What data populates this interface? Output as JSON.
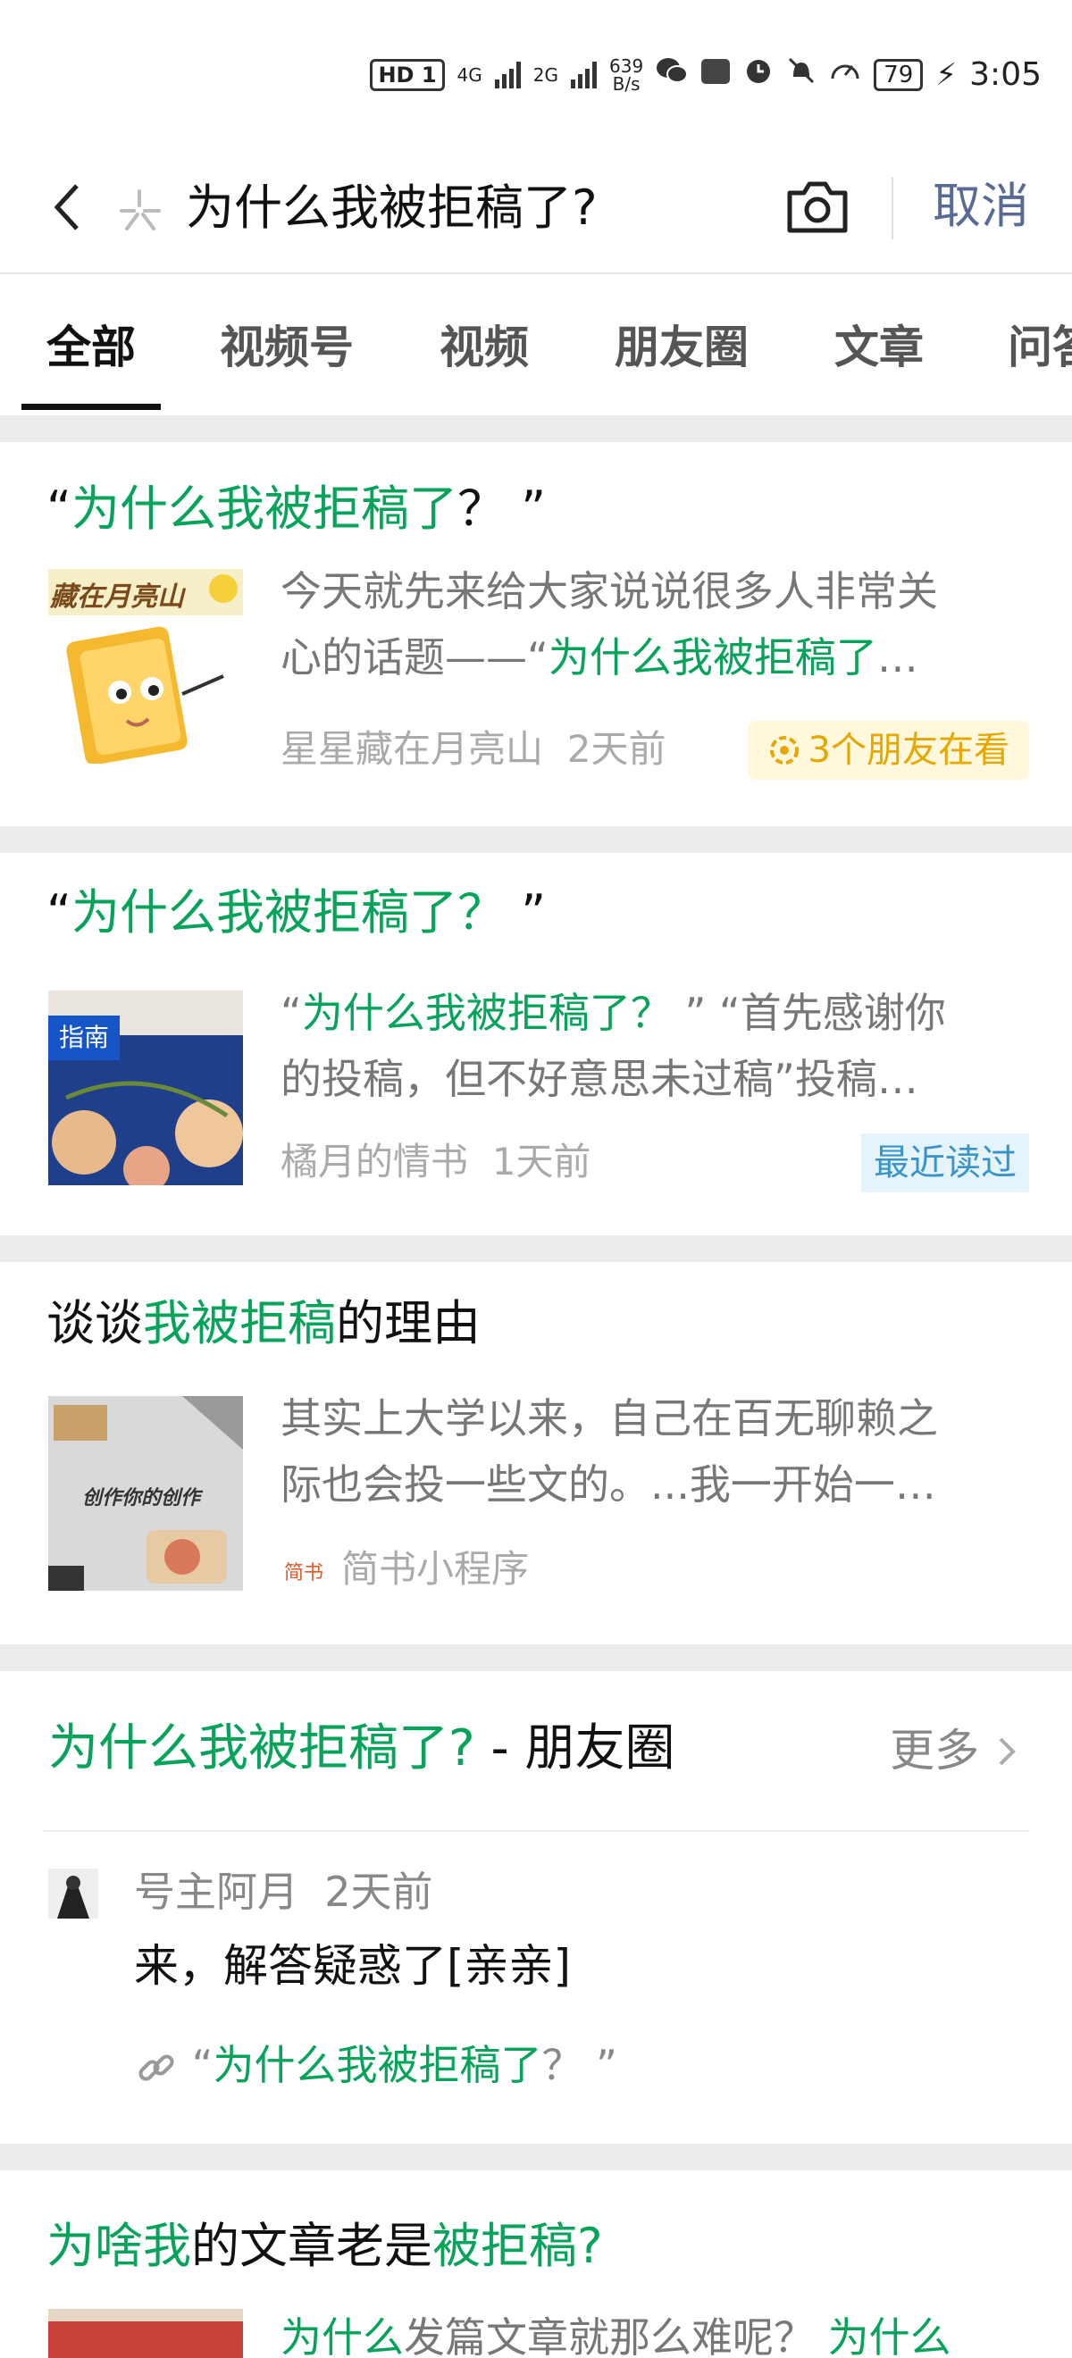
{
  "status_bar": {
    "hd_label": "HD",
    "sim1": "1",
    "net1": "4G",
    "net2": "2G",
    "speed_value": "639",
    "speed_unit": "B/s",
    "battery": "79",
    "time": "3:05",
    "icons": [
      "hd-icon",
      "signal-4g-icon",
      "signal-2g-icon",
      "wechat-icon",
      "hms-icon",
      "alarm-icon",
      "mute-bell-icon",
      "speed-dial-icon",
      "battery-icon",
      "charging-icon"
    ]
  },
  "search": {
    "query": "为什么我被拒稿了?",
    "cancel_label": "取消"
  },
  "tabs": [
    {
      "label": "全部",
      "active": true
    },
    {
      "label": "视频号"
    },
    {
      "label": "视频"
    },
    {
      "label": "朋友圈"
    },
    {
      "label": "文章"
    },
    {
      "label": "问答"
    }
  ],
  "results": [
    {
      "title_open": "“",
      "title_hl": "为什么我被拒稿了",
      "title_close": "？ ”",
      "thumb_caption": "藏在月亮山",
      "snippet_line1": "今天就先来给大家说说很多人非常关",
      "snippet_line2_pre": "心的话题——“",
      "snippet_line2_hl": "为什么我被拒稿了",
      "snippet_line2_post": "…",
      "author": "星星藏在月亮山",
      "time": "2天前",
      "badge": "3个朋友在看"
    },
    {
      "title_open": "“",
      "title_hl": "为什么我被拒稿了？",
      "title_close": " ”",
      "thumb_caption": "指南",
      "snippet_line1_q": "“",
      "snippet_line1_hl": "为什么我被拒稿了？",
      "snippet_line1_post": " ” “首先感谢你",
      "snippet_line2": "的投稿，但不好意思未过稿”投稿…",
      "author": "橘月的情书",
      "time": "1天前",
      "badge": "最近读过"
    },
    {
      "title_pre": "谈谈",
      "title_hl": "我被拒稿",
      "title_post": "的理由",
      "thumb_caption": "创作你的创作",
      "snippet_line1": "其实上大学以来，自己在百无聊赖之",
      "snippet_line2": "际也会投一些文的。...我一开始一…",
      "source_tag": "简书",
      "source": "简书小程序"
    }
  ],
  "moments": {
    "title_hl": "为什么我被拒稿了?",
    "title_post": " - 朋友圈",
    "more_label": "更多",
    "author": "号主阿月",
    "time": "2天前",
    "text": "来，解答疑惑了[亲亲]",
    "link_open": "“",
    "link_hl": "为什么我被拒稿了",
    "link_close": "？ ”"
  },
  "result4": {
    "title_hl1": "为啥我",
    "title_mid": "的文章老是",
    "title_hl2": "被拒稿?",
    "snippet_hl1": "为什么",
    "snippet_mid": "发篇文章就那么难呢？ ",
    "snippet_hl2": "为什么"
  }
}
